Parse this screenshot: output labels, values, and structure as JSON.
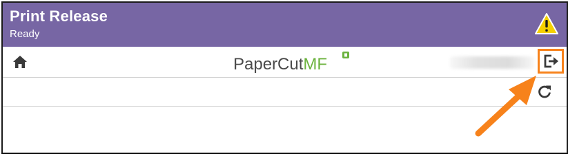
{
  "header": {
    "title": "Print Release",
    "status": "Ready",
    "warning_icon": "warning-triangle-icon",
    "background_color": "#7766a4"
  },
  "toolbar": {
    "home_icon": "home-icon",
    "logo": {
      "part1": "PaperCut",
      "part2": "MF"
    },
    "logout_icon": "logout-icon"
  },
  "content": {
    "refresh_icon": "refresh-icon"
  },
  "annotation": {
    "arrow_color": "#f7821b"
  }
}
